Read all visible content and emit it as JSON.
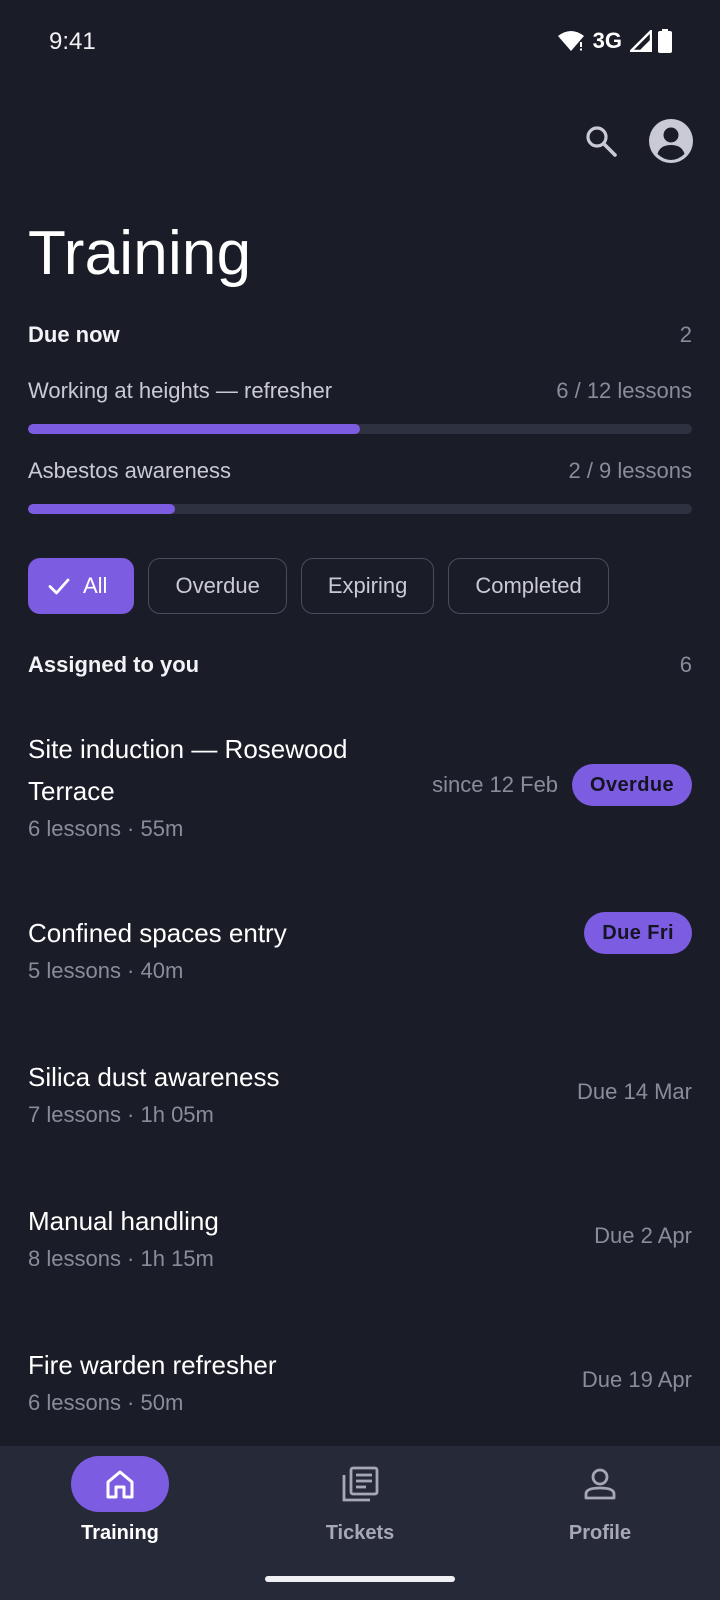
{
  "status_bar": {
    "time": "9:41",
    "network": "3G"
  },
  "header": {
    "title": "Training"
  },
  "due_now": {
    "label": "Due now",
    "count": "2",
    "items": [
      {
        "title": "Working at heights — refresher",
        "progress_text": "6 / 12 lessons",
        "progress": 0.5
      },
      {
        "title": "Asbestos awareness",
        "progress_text": "2 / 9 lessons",
        "progress": 0.222
      }
    ]
  },
  "filters": {
    "chips": [
      {
        "label": "All",
        "selected": true
      },
      {
        "label": "Overdue",
        "selected": false
      },
      {
        "label": "Expiring",
        "selected": false
      },
      {
        "label": "Completed",
        "selected": false
      }
    ]
  },
  "assigned": {
    "label": "Assigned to you",
    "count": "6",
    "courses": [
      {
        "title": "Site induction — Rosewood Terrace",
        "meta": "6 lessons · 55m",
        "date": "since 12 Feb",
        "badge": "Overdue"
      },
      {
        "title": "Confined spaces entry",
        "meta": "5 lessons · 40m",
        "date": "",
        "badge": "Due Fri"
      },
      {
        "title": "Silica dust awareness",
        "meta": "7 lessons · 1h 05m",
        "date": "Due 14 Mar",
        "badge": ""
      },
      {
        "title": "Manual handling",
        "meta": "8 lessons · 1h 15m",
        "date": "Due 2 Apr",
        "badge": ""
      },
      {
        "title": "Fire warden refresher",
        "meta": "6 lessons · 50m",
        "date": "Due 19 Apr",
        "badge": ""
      }
    ]
  },
  "bottom_nav": {
    "items": [
      {
        "label": "Training",
        "icon": "home-icon",
        "active": true
      },
      {
        "label": "Tickets",
        "icon": "tickets-icon",
        "active": false
      },
      {
        "label": "Profile",
        "icon": "profile-icon",
        "active": false
      }
    ]
  },
  "colors": {
    "accent": "#7c5ce0",
    "background": "#1a1c27",
    "nav_background": "#262938"
  }
}
